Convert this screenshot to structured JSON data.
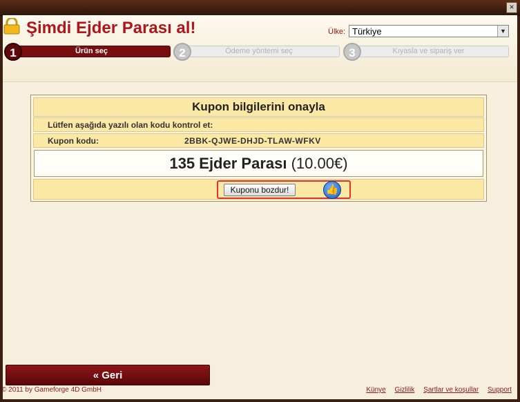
{
  "window": {
    "close_label": "×"
  },
  "header": {
    "title": "Şimdi Ejder Parası al!",
    "country_label": "Ülke:",
    "country_value": "Türkiye"
  },
  "steps": [
    {
      "number": "1",
      "label": "Ürün seç",
      "active": true
    },
    {
      "number": "2",
      "label": "Ödeme yöntemi seç",
      "active": false
    },
    {
      "number": "3",
      "label": "Kıyasla ve sipariş ver",
      "active": false
    }
  ],
  "coupon": {
    "heading": "Kupon bilgilerini onayla",
    "instruction": "Lütfen aşağıda yazılı olan kodu kontrol et:",
    "code_label": "Kupon kodu:",
    "code_value": "2BBK-QJWE-DHJD-TLAW-WFKV",
    "amount": "135 Ejder Parası",
    "price": "(10.00€)",
    "redeem_label": "Kuponu bozdur!"
  },
  "nav": {
    "back_label": "« Geri"
  },
  "footer": {
    "copyright": "© 2011 by Gameforge 4D GmbH",
    "links": [
      "Künye",
      "Gizlilik",
      "Şartlar ve koşullar",
      "Support"
    ]
  },
  "colors": {
    "brand_red": "#b0151b",
    "active_step": "#7a0d10",
    "panel_yellow": "#fbe8a5"
  }
}
